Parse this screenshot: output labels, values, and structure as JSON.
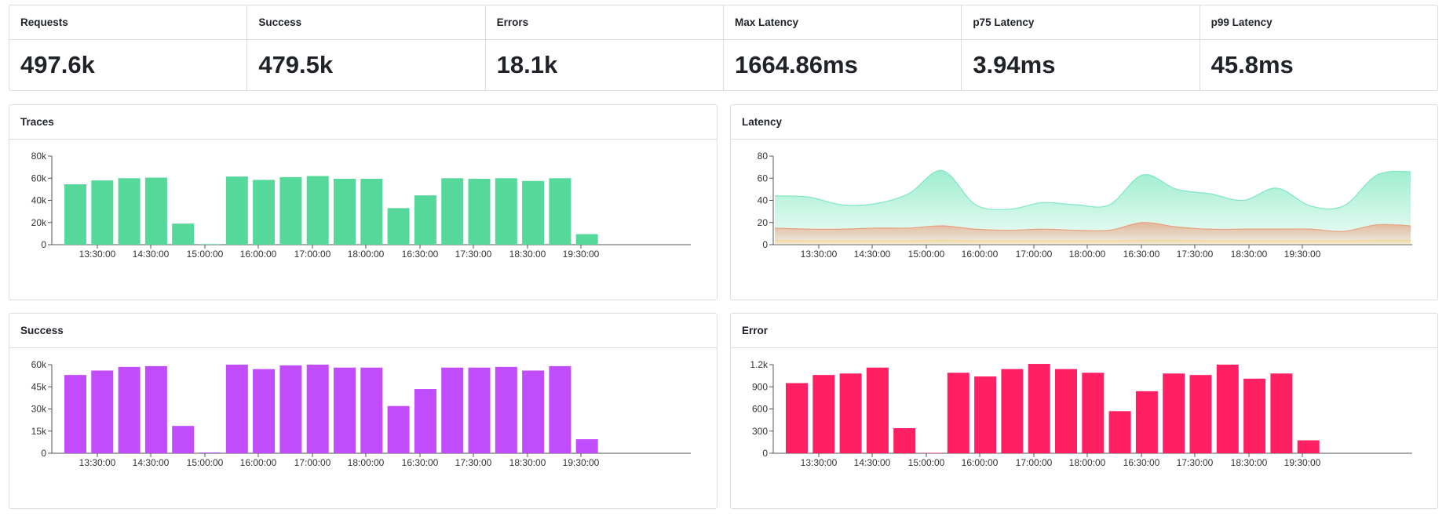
{
  "stats": [
    {
      "label": "Requests",
      "value": "497.6k"
    },
    {
      "label": "Success",
      "value": "479.5k"
    },
    {
      "label": "Errors",
      "value": "18.1k"
    },
    {
      "label": "Max Latency",
      "value": "1664.86ms"
    },
    {
      "label": "p75 Latency",
      "value": "3.94ms"
    },
    {
      "label": "p99 Latency",
      "value": "45.8ms"
    }
  ],
  "panels": {
    "traces": {
      "title": "Traces"
    },
    "latency": {
      "title": "Latency"
    },
    "success": {
      "title": "Success"
    },
    "error": {
      "title": "Error"
    }
  },
  "colors": {
    "traces": "#55d89a",
    "success": "#c04cfb",
    "error": "#ff1f63",
    "latency_top": "#7ee8c0",
    "latency_mid": "#e9a07f",
    "latency_low": "#f5d79a"
  },
  "chart_data": [
    {
      "id": "traces",
      "type": "bar",
      "title": "Traces",
      "x_ticks": [
        "13:30:00",
        "14:30:00",
        "15:00:00",
        "16:00:00",
        "17:00:00",
        "18:00:00",
        "16:30:00",
        "17:30:00",
        "18:30:00",
        "19:30:00"
      ],
      "y_ticks": [
        "0",
        "20k",
        "40k",
        "60k",
        "80k"
      ],
      "ylim": [
        0,
        80000
      ],
      "values": [
        54500,
        58000,
        60000,
        60500,
        19000,
        500,
        61500,
        58500,
        61000,
        62000,
        59500,
        59500,
        33000,
        44500,
        60000,
        59500,
        60000,
        57500,
        60000,
        9500
      ]
    },
    {
      "id": "latency",
      "type": "area",
      "title": "Latency",
      "x_ticks": [
        "13:30:00",
        "14:30:00",
        "15:00:00",
        "16:00:00",
        "17:00:00",
        "18:00:00",
        "16:30:00",
        "17:30:00",
        "18:30:00",
        "19:30:00"
      ],
      "y_ticks": [
        "0",
        "20",
        "40",
        "60",
        "80"
      ],
      "ylim": [
        0,
        80
      ],
      "series": [
        {
          "values": [
            44,
            43,
            36,
            37,
            46,
            67,
            36,
            32,
            38,
            36,
            36,
            63,
            50,
            46,
            40,
            51,
            35,
            35,
            63,
            66
          ]
        },
        {
          "values": [
            15,
            14,
            14,
            15,
            15,
            17,
            14,
            13,
            14,
            13,
            13,
            20,
            16,
            14,
            14,
            14,
            14,
            12,
            18,
            17
          ]
        },
        {
          "values": [
            4,
            3.5,
            3.5,
            3.5,
            3.5,
            4,
            3.5,
            3.5,
            3.5,
            3.5,
            3.5,
            4,
            4,
            3.5,
            3.5,
            3.5,
            3.5,
            3.5,
            4,
            4
          ]
        }
      ]
    },
    {
      "id": "success",
      "type": "bar",
      "title": "Success",
      "x_ticks": [
        "13:30:00",
        "14:30:00",
        "15:00:00",
        "16:00:00",
        "17:00:00",
        "18:00:00",
        "16:30:00",
        "17:30:00",
        "18:30:00",
        "19:30:00"
      ],
      "y_ticks": [
        "0",
        "15k",
        "30k",
        "45k",
        "60k"
      ],
      "ylim": [
        0,
        60000
      ],
      "values": [
        53000,
        56000,
        58500,
        59000,
        18500,
        500,
        60000,
        57000,
        59500,
        60000,
        58000,
        58000,
        32000,
        43500,
        58000,
        58000,
        58500,
        56000,
        59000,
        9500
      ]
    },
    {
      "id": "error",
      "type": "bar",
      "title": "Error",
      "x_ticks": [
        "13:30:00",
        "14:30:00",
        "15:00:00",
        "16:00:00",
        "17:00:00",
        "18:00:00",
        "16:30:00",
        "17:30:00",
        "18:30:00",
        "19:30:00"
      ],
      "y_ticks": [
        "0",
        "300",
        "600",
        "900",
        "1.2k"
      ],
      "ylim": [
        0,
        1200
      ],
      "values": [
        950,
        1060,
        1080,
        1160,
        340,
        5,
        1090,
        1040,
        1140,
        1210,
        1140,
        1090,
        570,
        840,
        1080,
        1060,
        1200,
        1010,
        1080,
        175
      ]
    }
  ]
}
